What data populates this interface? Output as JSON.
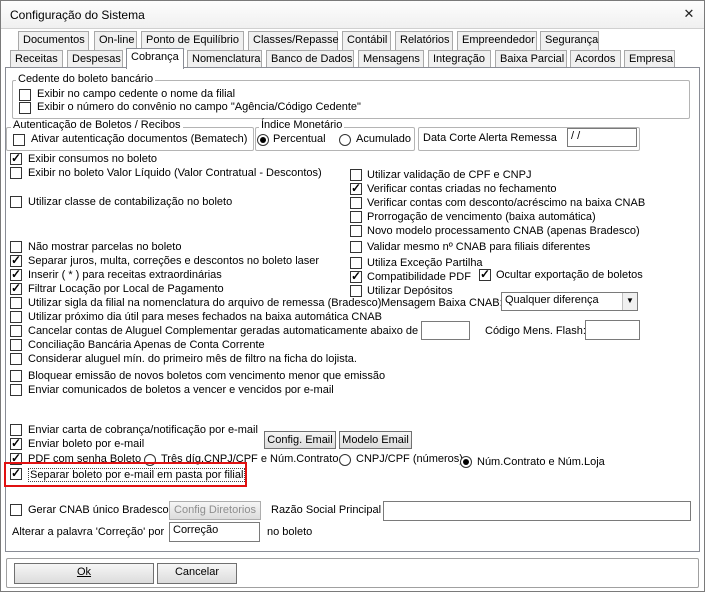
{
  "window": {
    "title": "Configuração do Sistema",
    "close_glyph": "✕"
  },
  "tabs_row1": [
    "Documentos",
    "On-line",
    "Ponto de Equilíbrio",
    "Classes/Repasse",
    "Contábil",
    "Relatórios",
    "Empreendedor",
    "Segurança"
  ],
  "tabs_row2": [
    "Receitas",
    "Despesas",
    "Cobrança",
    "Nomenclatura",
    "Banco de Dados",
    "Mensagens",
    "Integração",
    "Baixa Parcial",
    "Acordos",
    "Empresa"
  ],
  "active_tab": "Cobrança",
  "cedente": {
    "title": "Cedente do boleto bancário",
    "opt1": {
      "label": "Exibir no campo cedente o nome da filial",
      "checked": false
    },
    "opt2": {
      "label": "Exibir o número do convênio no campo \"Agência/Código Cedente\"",
      "checked": false
    }
  },
  "autenticacao": {
    "title": "Autenticação de Boletos / Recibos",
    "opt": {
      "label": "Ativar autenticação documentos (Bematech)",
      "checked": false
    }
  },
  "indice": {
    "title": "Índice Monetário",
    "percentual": "Percentual",
    "acumulado": "Acumulado",
    "selected": "Percentual"
  },
  "data_corte": {
    "label": "Data Corte Alerta Remessa",
    "value": " /  /"
  },
  "left_checks": [
    {
      "label": "Exibir consumos no boleto",
      "checked": true
    },
    {
      "label": "Exibir no boleto Valor Líquido (Valor Contratual - Descontos)",
      "checked": false
    },
    {
      "label": "Utilizar classe de contabilização no boleto",
      "checked": false
    },
    {
      "label": "Não mostrar parcelas no boleto",
      "checked": false
    },
    {
      "label": "Separar juros, multa, correções e descontos no boleto laser",
      "checked": true
    },
    {
      "label": "Inserir ( * ) para receitas extraordinárias",
      "checked": true
    },
    {
      "label": "Filtrar Locação por Local de Pagamento",
      "checked": true
    },
    {
      "label": "Utilizar sigla da filial na nomenclatura do arquivo de remessa (Bradesco)",
      "checked": false
    },
    {
      "label": "Utilizar próximo dia útil para meses fechados na baixa automática CNAB",
      "checked": false
    },
    {
      "label": "Cancelar contas de Aluguel Complementar geradas automaticamente abaixo de R$",
      "checked": false
    },
    {
      "label": "Conciliação Bancária Apenas de Conta Corrente",
      "checked": false
    },
    {
      "label": "Considerar aluguel mín. do primeiro mês de filtro na ficha do lojista.",
      "checked": false
    },
    {
      "label": "Bloquear emissão de novos boletos com vencimento menor que emissão",
      "checked": false
    },
    {
      "label": "Enviar comunicados de boletos a vencer e vencidos por e-mail",
      "checked": false
    }
  ],
  "right_checks": [
    {
      "label": "Utilizar validação de CPF e CNPJ",
      "checked": false
    },
    {
      "label": "Verificar contas criadas no fechamento",
      "checked": true
    },
    {
      "label": "Verificar contas com desconto/acréscimo na baixa CNAB",
      "checked": false
    },
    {
      "label": "Prorrogação de vencimento (baixa automática)",
      "checked": false
    },
    {
      "label": "Novo modelo processamento CNAB (apenas Bradesco)",
      "checked": false
    },
    {
      "label": "Validar mesmo nº CNAB para filiais diferentes",
      "checked": false
    },
    {
      "label": "Utiliza Exceção Partilha",
      "checked": false
    },
    {
      "label": "Compatibilidade PDF",
      "checked": true
    },
    {
      "label": "Utilizar Depósitos",
      "checked": false
    }
  ],
  "ocultar_exportacao": {
    "label": "Ocultar exportação de boletos",
    "checked": true
  },
  "mensagem_baixa": {
    "label": "Mensagem Baixa CNAB:",
    "value": "Qualquer diferença"
  },
  "valor_minimo": {
    "value": ""
  },
  "codigo_flash": {
    "label": "Código Mens. Flash:",
    "value": ""
  },
  "email": {
    "carta": {
      "label": "Enviar carta de cobrança/notificação por e-mail",
      "checked": false
    },
    "boleto": {
      "label": "Enviar boleto por e-mail",
      "checked": true
    },
    "pdf": {
      "label": "PDF com senha Boleto",
      "checked": true
    },
    "config_email": "Config. Email",
    "modelo_email": "Modelo Email",
    "senha_opt1": "Três díg.CNPJ/CPF e Núm.Contrato",
    "senha_opt2": "CNPJ/CPF (números)",
    "senha_opt3": "Núm.Contrato e Núm.Loja",
    "senha_selected": "Núm.Contrato e Núm.Loja",
    "separar": {
      "label": "Separar boleto por e-mail em pasta por filial",
      "checked": true
    }
  },
  "cnab_bradesco": {
    "label": "Gerar CNAB único Bradesco",
    "checked": false,
    "config_button": "Config Diretorios"
  },
  "razao_social": {
    "label": "Razão Social Principal",
    "value": ""
  },
  "correcao": {
    "label_before": "Alterar a palavra 'Correção' por",
    "value": "Correção",
    "label_after": "no boleto"
  },
  "footer": {
    "ok": "Ok",
    "cancel": "Cancelar"
  },
  "colors": {
    "highlight": "#e01010"
  }
}
